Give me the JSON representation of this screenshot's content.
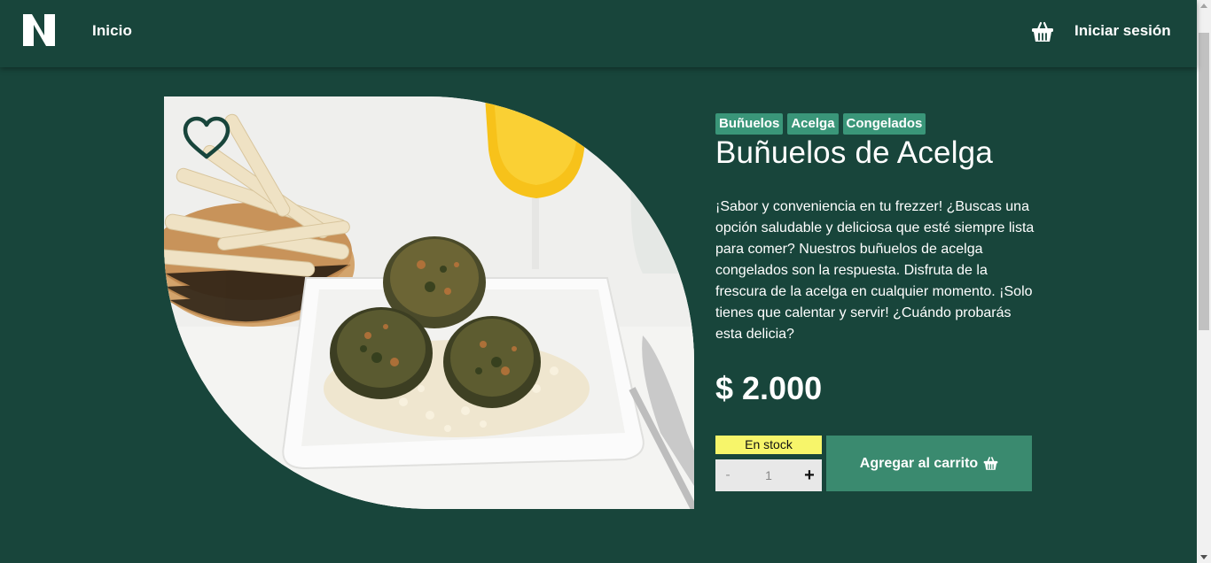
{
  "header": {
    "logo_letter": "N",
    "nav_home": "Inicio",
    "login": "Iniciar sesión",
    "cart_icon": "basket-icon"
  },
  "product": {
    "tags": [
      "Buñuelos",
      "Acelga",
      "Congelados"
    ],
    "title": "Buñuelos de Acelga",
    "description": "¡Sabor y conveniencia en tu frezzer! ¿Buscas una opción saludable y deliciosa que esté siempre lista para comer? Nuestros buñuelos de acelga congelados son la respuesta. Disfruta de la frescura de la acelga en cualquier momento. ¡Solo tienes que calentar y servir! ¿Cuándo probarás esta delicia?",
    "price": "$ 2.000",
    "stock_label": "En stock",
    "quantity": "1",
    "qty_minus": "-",
    "qty_plus": "+",
    "add_to_cart": "Agregar al carrito",
    "favorite_icon": "heart-icon"
  },
  "colors": {
    "background": "#18453b",
    "tag": "#3a9679",
    "button": "#3a8a6f",
    "stock_badge": "#f7f56a"
  }
}
